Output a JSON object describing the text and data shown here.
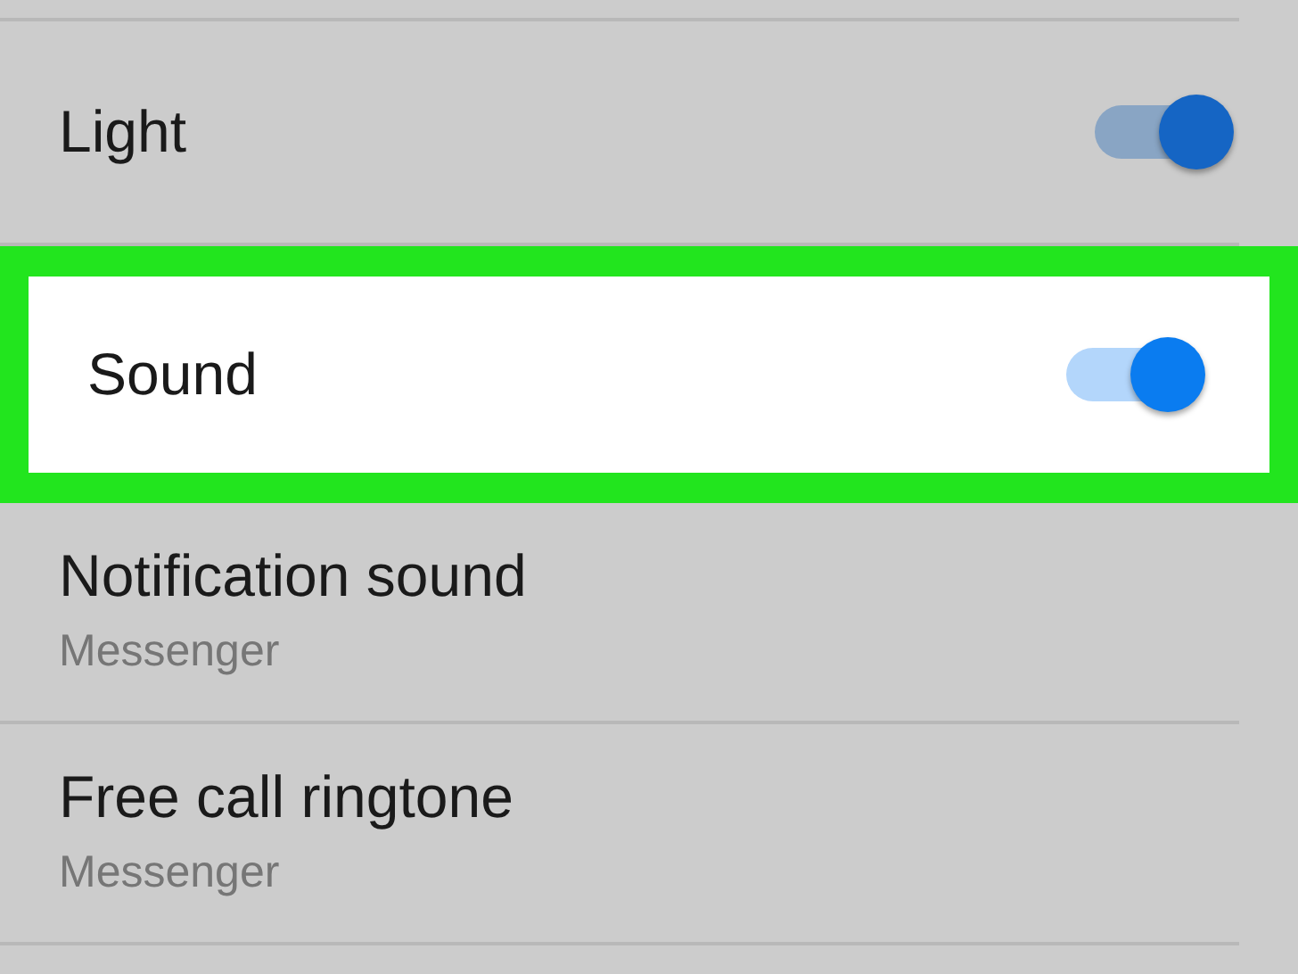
{
  "settings": [
    {
      "kind": "toggle",
      "title": "Light",
      "on": true,
      "highlighted": false
    },
    {
      "kind": "toggle",
      "title": "Sound",
      "on": true,
      "highlighted": true
    },
    {
      "kind": "choice",
      "title": "Notification sound",
      "value": "Messenger",
      "highlighted": false
    },
    {
      "kind": "choice",
      "title": "Free call ringtone",
      "value": "Messenger",
      "highlighted": false
    }
  ]
}
